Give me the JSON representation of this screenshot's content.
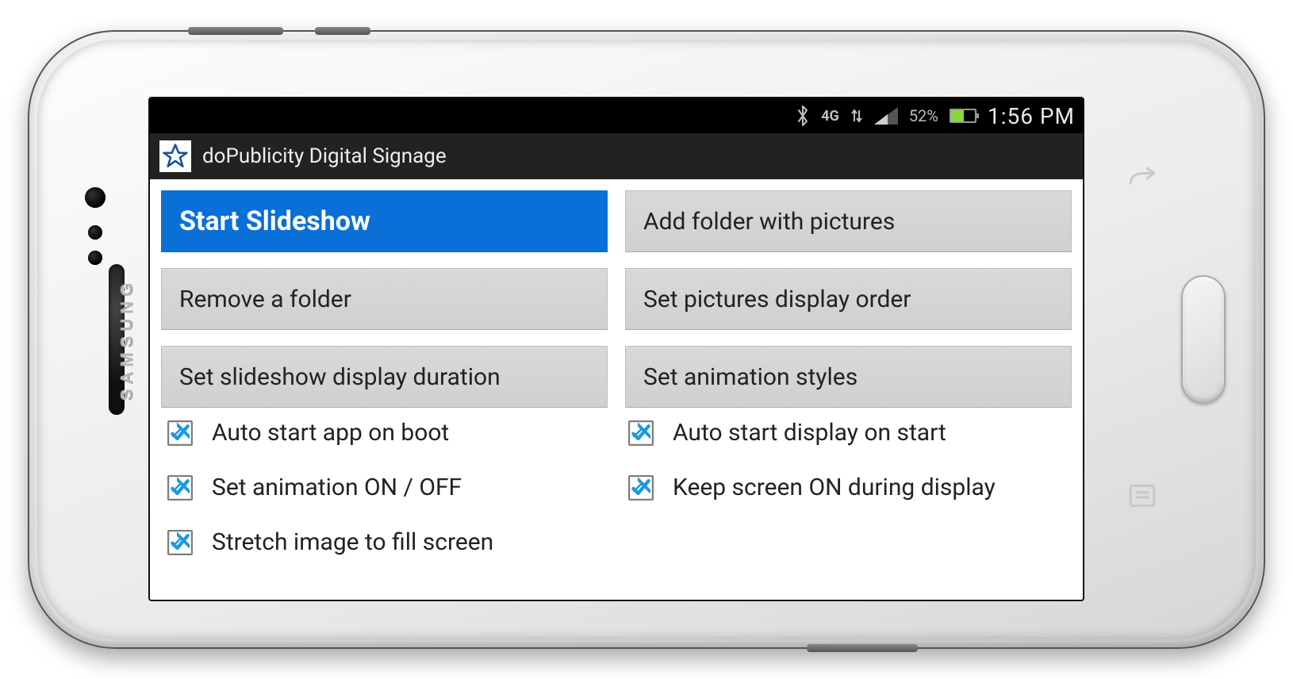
{
  "device": {
    "brand": "SAMSUNG"
  },
  "status_bar": {
    "network_label": "4G",
    "battery_percent": "52%",
    "clock": "1:56 PM"
  },
  "app_bar": {
    "title": "doPublicity Digital Signage"
  },
  "buttons": {
    "start_slideshow": "Start Slideshow",
    "add_folder": "Add folder with pictures",
    "remove_folder": "Remove a folder",
    "set_order": "Set pictures display order",
    "set_duration": "Set slideshow display duration",
    "set_anim_styles": "Set animation styles"
  },
  "checkboxes": {
    "auto_start_boot": {
      "label": "Auto start app on boot",
      "checked": true
    },
    "auto_start_display": {
      "label": "Auto start display on start",
      "checked": true
    },
    "anim_toggle": {
      "label": "Set animation ON / OFF",
      "checked": true
    },
    "keep_screen_on": {
      "label": "Keep screen ON during display",
      "checked": true
    },
    "stretch_fill": {
      "label": "Stretch image to fill screen",
      "checked": true
    }
  }
}
